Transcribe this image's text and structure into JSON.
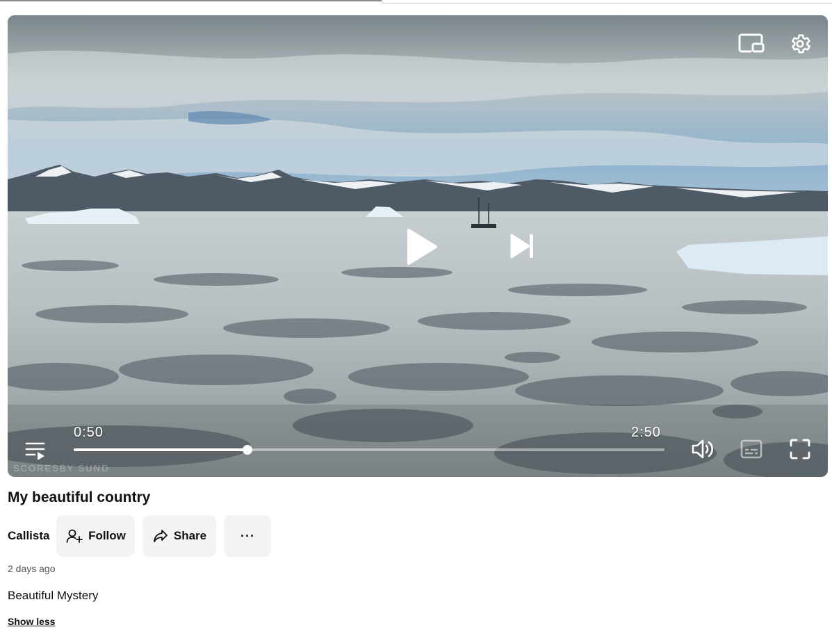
{
  "player": {
    "current_time": "0:50",
    "duration": "2:50",
    "progress_fraction": 0.294,
    "watermark": "SCORESBY SUND"
  },
  "video": {
    "title": "My beautiful country",
    "author": "Callista",
    "posted": "2 days ago",
    "description": "Beautiful Mystery"
  },
  "actions": {
    "follow_label": "Follow",
    "share_label": "Share",
    "more_label": "···",
    "show_less_label": "Show less"
  },
  "icons": {
    "top_right": [
      "pip-icon",
      "settings-gear-icon"
    ],
    "center": [
      "play-icon",
      "skip-next-icon"
    ],
    "bottom": [
      "playlist-icon",
      "volume-icon",
      "captions-icon",
      "fullscreen-icon"
    ],
    "buttons": [
      "follow-user-plus-icon",
      "share-arrow-icon",
      "more-dots-icon"
    ]
  },
  "colors": {
    "button_bg": "#f3f3f3",
    "controls": "#ffffff"
  }
}
